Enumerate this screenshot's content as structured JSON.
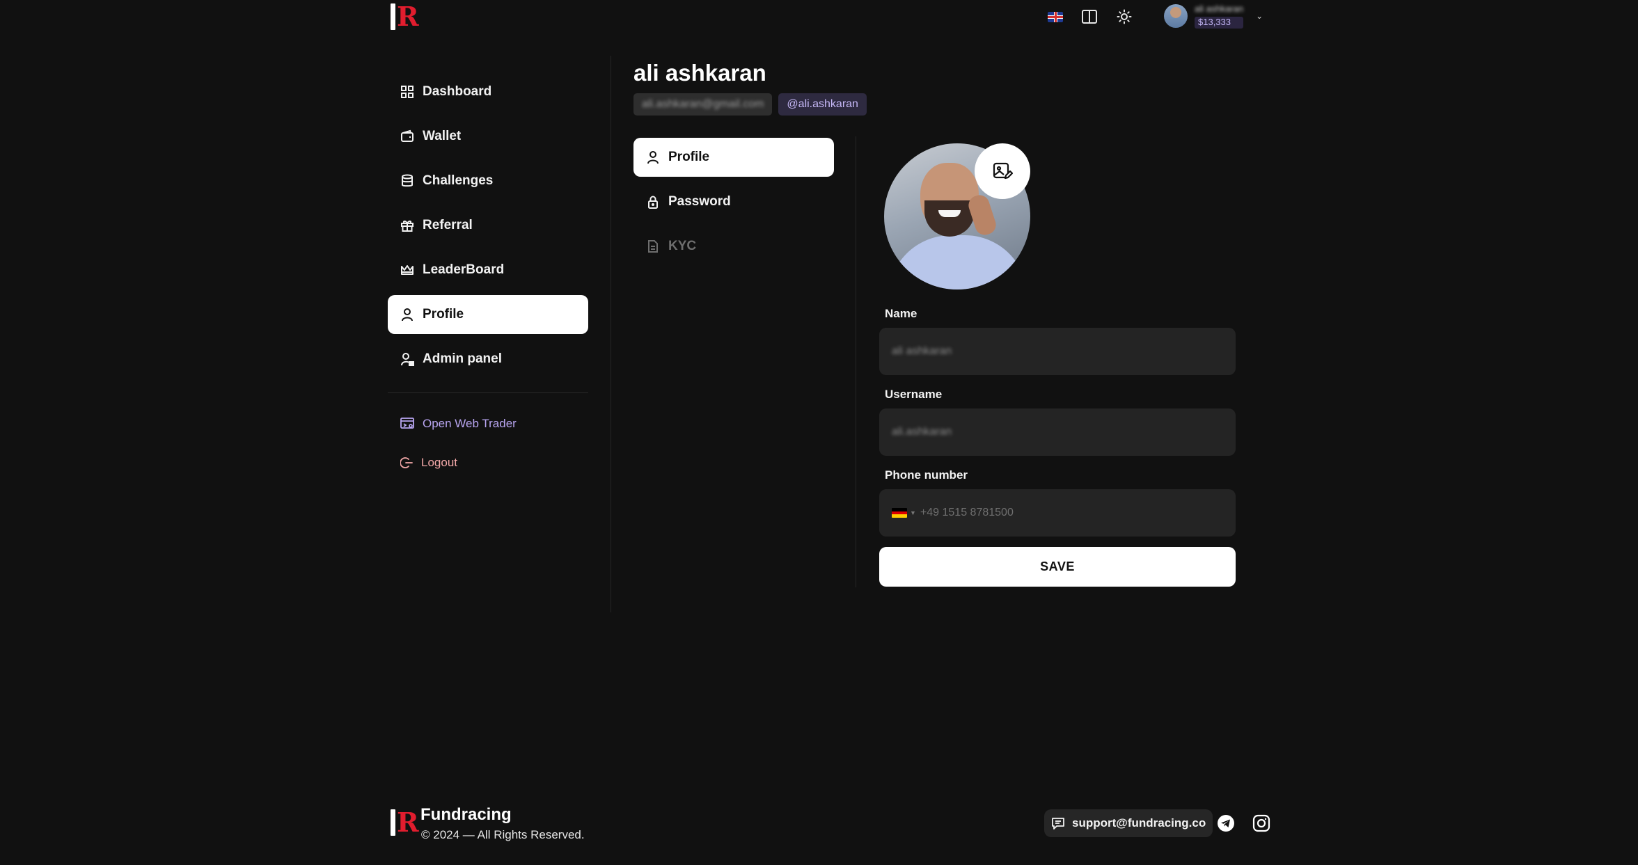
{
  "header": {
    "logo_letter": "R",
    "language": "English (UK)",
    "user_name": "ali ashkaran",
    "user_balance": "$13,333"
  },
  "sidebar": {
    "items": [
      {
        "label": "Dashboard",
        "icon": "grid-icon"
      },
      {
        "label": "Wallet",
        "icon": "wallet-icon"
      },
      {
        "label": "Challenges",
        "icon": "database-icon"
      },
      {
        "label": "Referral",
        "icon": "gift-icon"
      },
      {
        "label": "LeaderBoard",
        "icon": "crown-icon"
      },
      {
        "label": "Profile",
        "icon": "user-icon",
        "active": true
      },
      {
        "label": "Admin panel",
        "icon": "user-lock-icon"
      }
    ],
    "open_web_trader": "Open Web Trader",
    "logout": "Logout"
  },
  "profile": {
    "name": "ali ashkaran",
    "email": "ali.ashkaran@gmail.com",
    "handle": "@ali.ashkaran"
  },
  "tabs": [
    {
      "label": "Profile",
      "icon": "user-icon",
      "active": true
    },
    {
      "label": "Password",
      "icon": "lock-icon"
    },
    {
      "label": "KYC",
      "icon": "document-icon",
      "disabled": true
    }
  ],
  "form": {
    "name_label": "Name",
    "name_value": "ali ashkaran",
    "username_label": "Username",
    "username_value": "ali.ashkaran",
    "phone_label": "Phone number",
    "phone_placeholder": "+49 1515 8781500",
    "save_label": "SAVE"
  },
  "footer": {
    "brand": "Fundracing",
    "copyright": "© 2024 — All Rights Reserved.",
    "support_email": "support@fundracing.co"
  },
  "colors": {
    "background": "#111111",
    "accent_purple": "#b9a6f2",
    "logout_red": "#f4a9a9",
    "logo_red": "#e11d2e"
  }
}
